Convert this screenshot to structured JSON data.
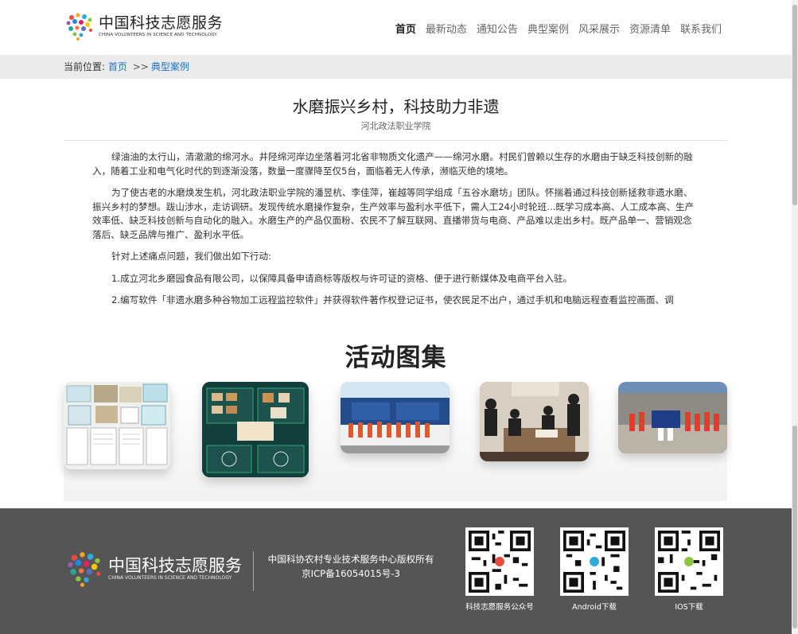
{
  "header": {
    "logo_cn": "中国科技志愿服务",
    "logo_en": "CHINA VOLUNTEERS IN SCIENCE AND TECHNOLOGY",
    "nav": [
      "首页",
      "最新动态",
      "通知公告",
      "典型案例",
      "风采展示",
      "资源清单",
      "联系我们"
    ]
  },
  "breadcrumb": {
    "label": "当前位置:",
    "home": "首页",
    "sep": ">>",
    "current": "典型案例"
  },
  "article": {
    "title": "水磨振兴乡村，科技助力非遗",
    "author": "河北政法职业学院",
    "paragraphs": [
      "绿油油的太行山，清澈澈的绵河水。井陉绵河岸边坐落着河北省非物质文化遗产——绵河水磨。村民们曾赖以生存的水磨由于缺乏科技创新的融入，随着工业和电气化时代的到逐渐没落，数量一度骤降至仅5台，面临着无人传承，濒临灭绝的境地。",
      "为了使古老的水磨焕发生机，河北政法职业学院的潘昱杭、李佳萍，崔越等同学组成「五谷水磨坊」团队。怀揣着通过科技创新拯救非遗水磨、振兴乡村的梦想。跋山涉水，走访调研。发现传统水磨操作复杂，生产效率与盈利水平低下，需人工24小时轮班...既学习成本高、人工成本高、生产效率低、缺乏科技创新与自动化的融入。水磨生产的产品仅面粉、农民不了解互联网、直播带货与电商、产品难以走出乡村。既产品单一、营销观念落后、缺乏品牌与推广、盈利水平低。",
      "针对上述痛点问题，我们做出如下行动:",
      "1.成立河北乡磨园食品有限公司，以保障具备申请商标等版权与许可证的资格、便于进行新媒体及电商平台入驻。",
      "2.编写软件「非遗水磨多种谷物加工远程监控软件」并获得软件著作权登记证书，使农民足不出户，通过手机和电脑远程查看监控画面、调"
    ]
  },
  "gallery": {
    "title": "活动图集"
  },
  "footer": {
    "logo_cn": "中国科技志愿服务",
    "logo_en": "CHINA VOLUNTEERS IN SCIENCE AND TECHNOLOGY",
    "copyright": "中国科协农村专业技术服务中心版权所有",
    "icp": "京ICP备16054015号-3",
    "qrcodes": [
      "科技志愿服务公众号",
      "Android下载",
      "IOS下载"
    ]
  }
}
